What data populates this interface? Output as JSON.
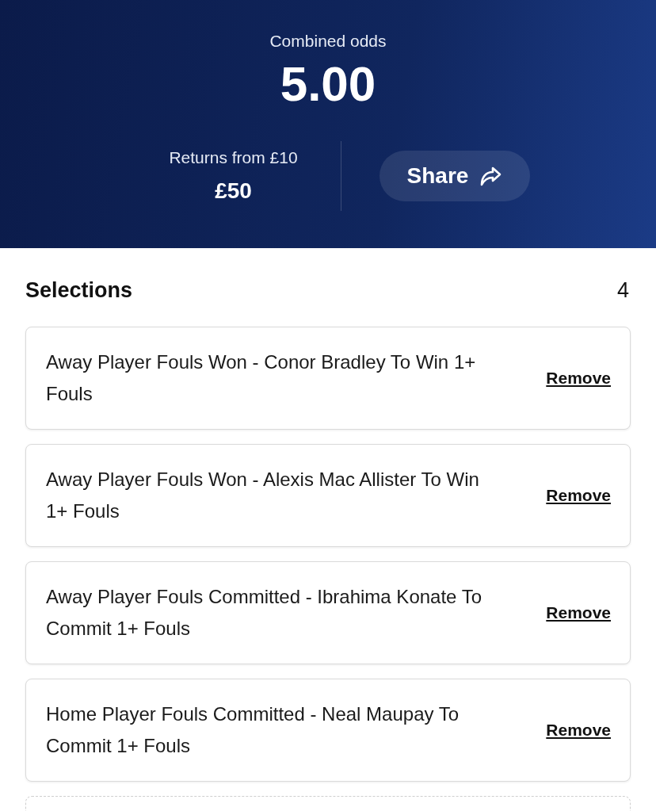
{
  "header": {
    "combined_odds_label": "Combined odds",
    "combined_odds": "5.00",
    "returns_label": "Returns from £10",
    "returns": "£50",
    "share_button": "Share"
  },
  "selections": {
    "title": "Selections",
    "count": "4",
    "items": [
      {
        "text": "Away Player Fouls Won - Conor Bradley To Win 1+ Fouls",
        "action": "Remove"
      },
      {
        "text": "Away Player Fouls Won - Alexis Mac Allister To Win 1+ Fouls",
        "action": "Remove"
      },
      {
        "text": "Away Player Fouls Committed - Ibrahima Konate To Commit 1+ Fouls",
        "action": "Remove"
      },
      {
        "text": "Home Player Fouls Committed - Neal Maupay To Commit 1+ Fouls",
        "action": "Remove"
      }
    ]
  }
}
